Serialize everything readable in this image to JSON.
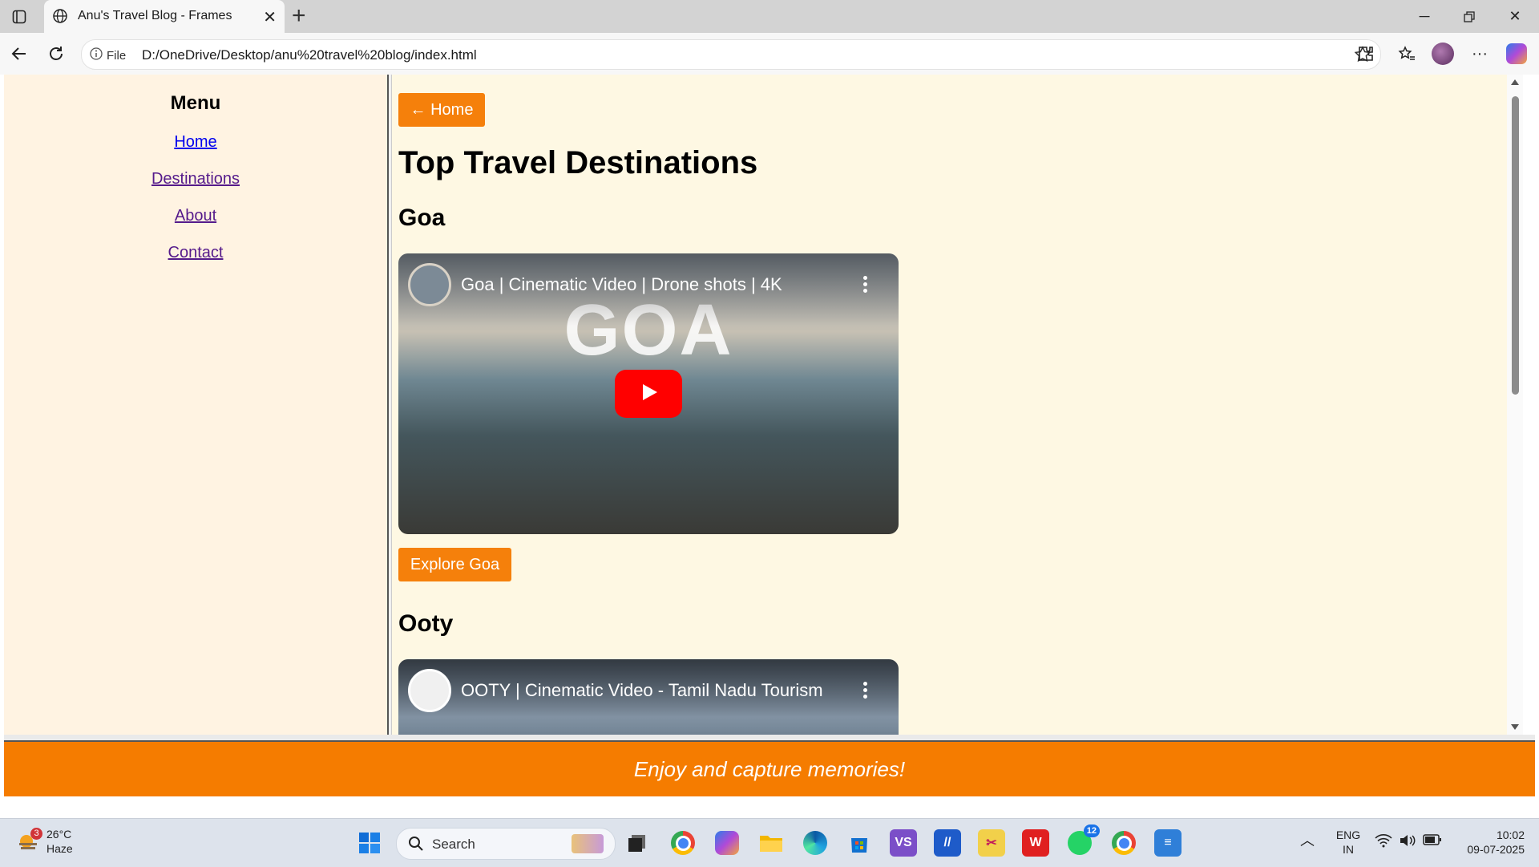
{
  "browser": {
    "tab_title": "Anu's Travel Blog - Frames",
    "url_scheme_label": "File",
    "url": "D:/OneDrive/Desktop/anu%20travel%20blog/index.html"
  },
  "sidebar": {
    "heading": "Menu",
    "links": [
      {
        "label": "Home"
      },
      {
        "label": "Destinations"
      },
      {
        "label": "About"
      },
      {
        "label": "Contact"
      }
    ]
  },
  "main": {
    "home_button": "← Home",
    "title": "Top Travel Destinations",
    "sections": [
      {
        "heading": "Goa",
        "video_title": "Goa | Cinematic Video | Drone shots | 4K",
        "thumbnail_text": "GOA",
        "button": "Explore Goa"
      },
      {
        "heading": "Ooty",
        "video_title": "OOTY | Cinematic Video - Tamil Nadu Tourism"
      }
    ]
  },
  "footer": {
    "text": "Enjoy and capture memories!"
  },
  "taskbar": {
    "weather_temp": "26°C",
    "weather_desc": "Haze",
    "weather_badge": "3",
    "search_placeholder": "Search",
    "whatsapp_badge": "12",
    "language": "ENG",
    "region": "IN",
    "time": "10:02",
    "date": "09-07-2025"
  },
  "colors": {
    "accent": "#f5800b",
    "sidebar_bg": "#fff3e2",
    "main_bg": "#fef8e3",
    "link": "#551a8b",
    "footer_bg": "#f57c00"
  }
}
